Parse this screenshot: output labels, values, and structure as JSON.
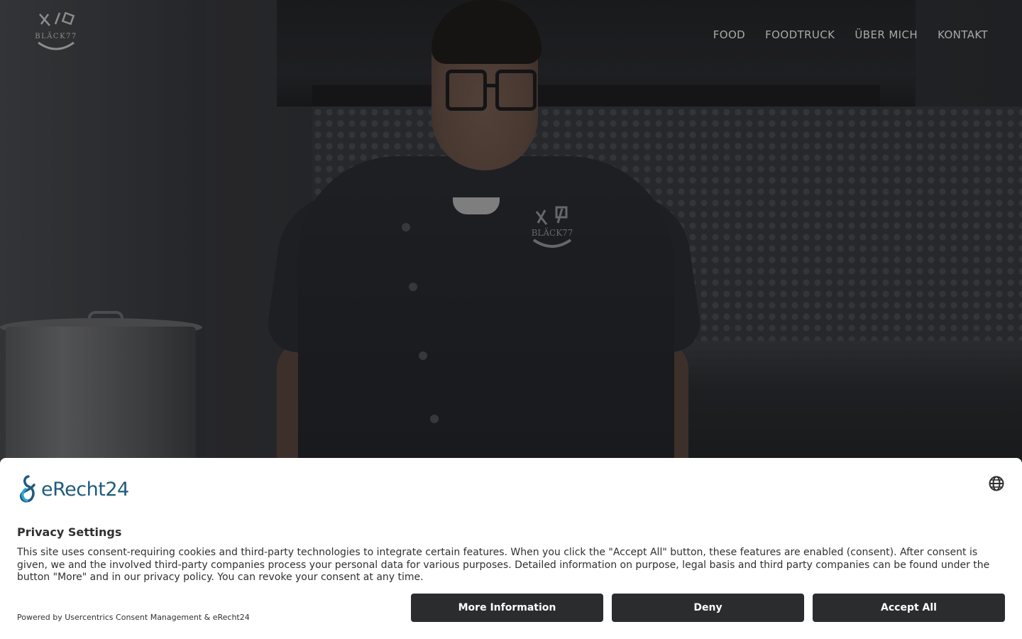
{
  "header": {
    "logo_alt": "BLÄCK77",
    "nav": [
      {
        "label": "FOOD"
      },
      {
        "label": "FOODTRUCK"
      },
      {
        "label": "ÜBER MICH"
      },
      {
        "label": "KONTAKT"
      }
    ]
  },
  "hero": {
    "chest_logo_text": "BLÄCK77"
  },
  "consent": {
    "brand": "eRecht24",
    "language_icon": "globe-icon",
    "title": "Privacy Settings",
    "description": "This site uses consent-requiring cookies and third-party technologies to integrate certain features. When you click the \"Accept All\" button, these features are enabled (consent). After consent is given, we and the involved third-party companies process your personal data for various purposes. Detailed information on purpose, legal basis and third party companies can be found under the button \"More\" and in our privacy policy. You can revoke your consent at any time.",
    "powered_by": "Powered by Usercentrics Consent Management & eRecht24",
    "buttons": {
      "more": "More Information",
      "deny": "Deny",
      "accept": "Accept All"
    }
  },
  "colors": {
    "brand_blue": "#205b7d",
    "button_bg": "#2b2c2e",
    "nav_text": "#a9a9a9"
  }
}
